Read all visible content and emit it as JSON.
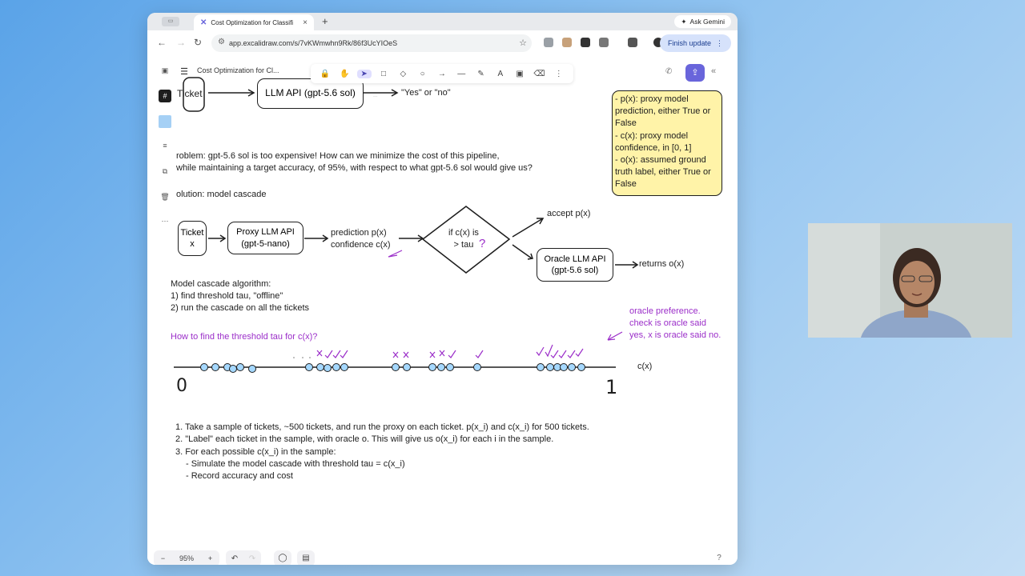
{
  "browser": {
    "side_tab_label": "▭",
    "tab_title": "Cost Optimization for Classifi",
    "tab_close": "×",
    "new_tab": "+",
    "ask_gemini": "Ask Gemini",
    "url": "app.excalidraw.com/s/7vKWmwhn9Rk/86f3UcYIOeS",
    "finish_update": "Finish update"
  },
  "app": {
    "doc_title": "Cost Optimization for Cl...",
    "tools": [
      "🔒",
      "✋",
      "➤",
      "□",
      "◇",
      "○",
      "→",
      "—",
      "✎",
      "A",
      "▣",
      "⌫",
      "⋮"
    ],
    "shape_hint": "...",
    "zoom_minus": "−",
    "zoom_level": "95%",
    "zoom_plus": "+",
    "undo": "↶",
    "redo": "↷"
  },
  "canvas": {
    "top_ticket": "Ticket",
    "top_llm": "LLM API (gpt-5.6 sol)",
    "top_yesno": "\"Yes\" or \"no\"",
    "problem_line1": "roblem: gpt-5.6 sol is too expensive! How can we minimize the cost of this pipeline,",
    "problem_line2": "while maintaining a target accuracy, of 95%, with respect to what gpt-5.6 sol would give us?",
    "solution": "olution: model cascade",
    "flow_ticket": "Ticket\nx",
    "flow_proxy": "Proxy LLM API\n(gpt-5-nano)",
    "flow_pred": "prediction p(x)\nconfidence c(x)",
    "flow_diamond": "if c(x) is\n> tau",
    "flow_q": "?",
    "flow_accept": "accept p(x)",
    "flow_oracle": "Oracle LLM API\n(gpt-5.6 sol)",
    "flow_returns": "returns o(x)",
    "note": "- p(x): proxy model prediction, either True or False\n- c(x): proxy model confidence, in [0, 1]\n- o(x): assumed ground truth label, either True or False",
    "algo_title": "Model cascade algorithm:",
    "algo_1": "1) find threshold tau, \"offline\"",
    "algo_2": "2) run the cascade on all the tickets",
    "how_to": "How to find the threshold tau for c(x)?",
    "oracle_pref": "oracle preference.\ncheck is oracle said\nyes, x is oracle said no.",
    "axis_label": "c(x)",
    "axis_zero": "0",
    "axis_one": "1",
    "step1": "1. Take a sample of tickets, ~500 tickets, and run the proxy on each ticket. p(x_i) and c(x_i) for 500 tickets.",
    "step2": "2. \"Label\" each ticket in the sample, with oracle o. This will give us o(x_i) for each i in the sample.",
    "step3": "3. For each possible c(x_i) in the sample:",
    "step3a": "- Simulate the model cascade with threshold tau = c(x_i)",
    "step3b": "- Record accuracy and cost"
  },
  "colors": {
    "accent": "#6965db",
    "annotation": "#9b2ec9",
    "note_fill": "#fff3a8",
    "dot_fill": "#a5d8ff"
  }
}
